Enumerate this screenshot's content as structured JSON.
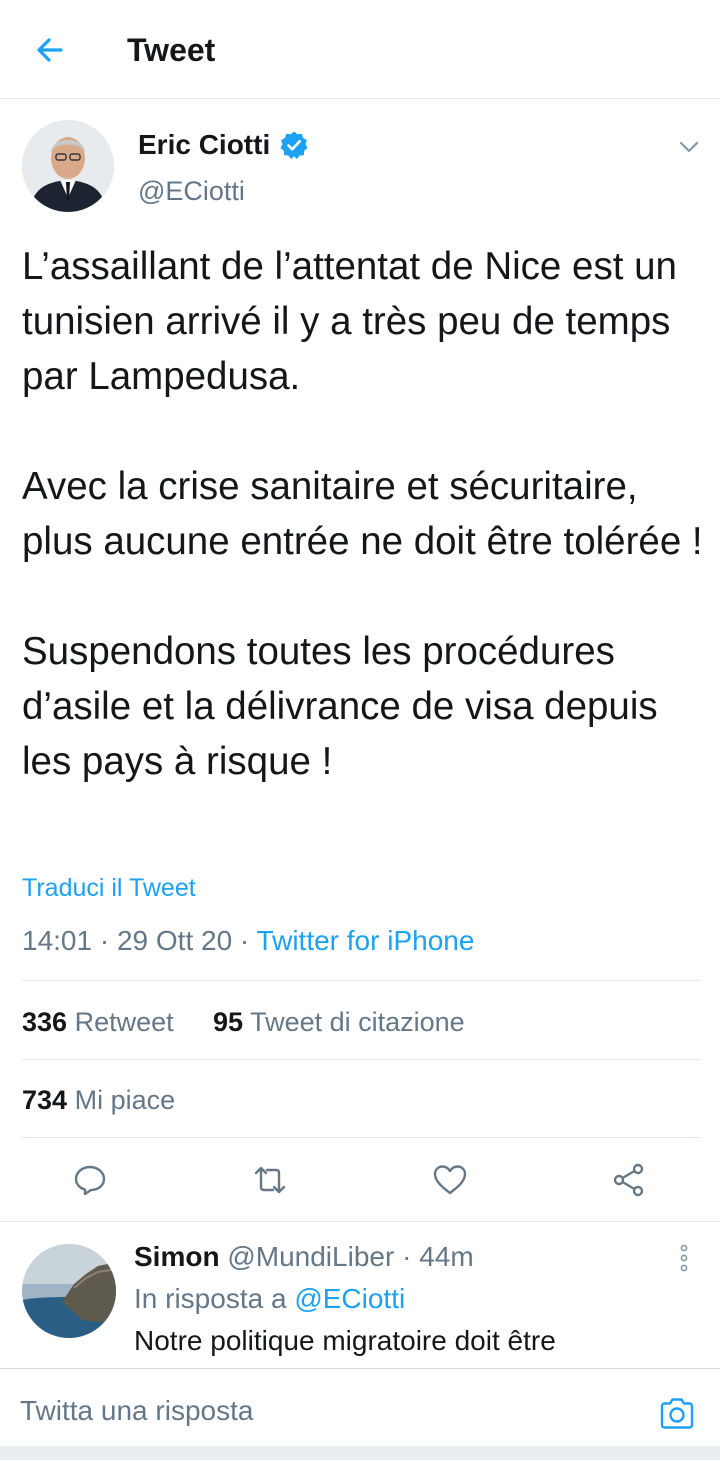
{
  "header": {
    "title": "Tweet",
    "back_icon": "arrow-left-icon"
  },
  "tweet": {
    "author": {
      "name": "Eric Ciotti",
      "handle": "@ECiotti",
      "verified": true
    },
    "paragraphs": [
      "L’assaillant de l’attentat de Nice est un tunisien arrivé il y a très peu de temps par Lampedusa.",
      "Avec la crise sanitaire et sécuritaire, plus aucune entrée ne doit être tolérée !",
      "Suspendons toutes les procédures d’asile et la délivrance de visa depuis les pays à risque !"
    ],
    "translate_label": "Traduci il Tweet",
    "time": "14:01",
    "date": "29 Ott 20",
    "source": "Twitter for iPhone",
    "separator": " · ",
    "stats": {
      "retweets": "336",
      "retweets_label": "Retweet",
      "quotes": "95",
      "quotes_label": "Tweet di citazione",
      "likes": "734",
      "likes_label": "Mi piace"
    },
    "actions": [
      "reply-icon",
      "retweet-icon",
      "like-icon",
      "share-icon"
    ]
  },
  "reply": {
    "name": "Simon",
    "handle": "@MundiLiber",
    "time": "44m",
    "dot": " · ",
    "in_reply_label": "In risposta a",
    "in_reply_handle": "@ECiotti",
    "text": "Notre politique migratoire doit être"
  },
  "composer": {
    "placeholder": "Twitta una risposta",
    "camera_icon": "camera-icon"
  },
  "colors": {
    "accent": "#1da1f2",
    "secondary_text": "#657786",
    "text": "#14171a",
    "divider": "#e1e8ed"
  }
}
